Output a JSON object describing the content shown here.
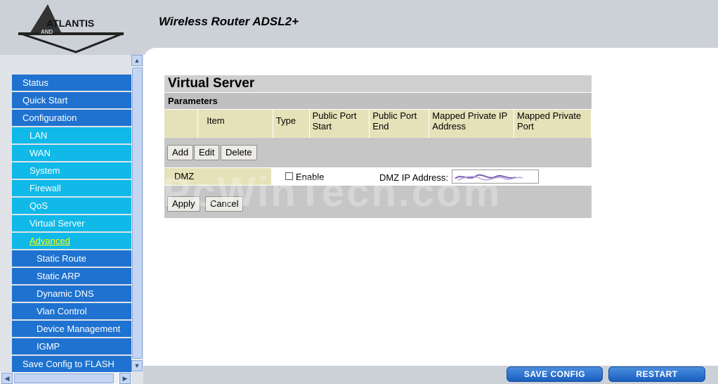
{
  "header": {
    "app_title": "Wireless Router ADSL2+",
    "logo_text_1": "ATLANTIS",
    "logo_text_2": "AND"
  },
  "sidebar": {
    "items": [
      {
        "label": "Status",
        "level": 1
      },
      {
        "label": "Quick Start",
        "level": 1
      },
      {
        "label": "Configuration",
        "level": 1
      },
      {
        "label": "LAN",
        "level": 2
      },
      {
        "label": "WAN",
        "level": 2
      },
      {
        "label": "System",
        "level": 2
      },
      {
        "label": "Firewall",
        "level": 2
      },
      {
        "label": "QoS",
        "level": 2
      },
      {
        "label": "Virtual Server",
        "level": 2
      },
      {
        "label": "Advanced",
        "level": 2,
        "active": true
      },
      {
        "label": "Static Route",
        "level": 3
      },
      {
        "label": "Static ARP",
        "level": 3
      },
      {
        "label": "Dynamic DNS",
        "level": 3
      },
      {
        "label": "Vlan Control",
        "level": 3
      },
      {
        "label": "Device Management",
        "level": 3
      },
      {
        "label": "IGMP",
        "level": 3
      },
      {
        "label": "Save Config to FLASH",
        "level": 1
      }
    ]
  },
  "main": {
    "page_title": "Virtual Server",
    "section_title": "Parameters",
    "table_headers": [
      "",
      "Item",
      "Type",
      "Public Port Start",
      "Public Port End",
      "Mapped Private IP Address",
      "Mapped Private Port"
    ],
    "buttons": {
      "add": "Add",
      "edit": "Edit",
      "delete": "Delete",
      "apply": "Apply",
      "cancel": "Cancel"
    },
    "dmz": {
      "label": "DMZ",
      "enable_label": "Enable",
      "enabled": false,
      "ip_label": "DMZ IP Address:",
      "ip_value": ""
    }
  },
  "footer": {
    "save_config": "SAVE CONFIG",
    "restart": "RESTART"
  },
  "watermark": "PcWinTech.com",
  "colors": {
    "nav_blue": "#1f72cf",
    "nav_cyan": "#10b9e8",
    "header_gray": "#ccd1d8",
    "table_header": "#e5e2b9"
  }
}
